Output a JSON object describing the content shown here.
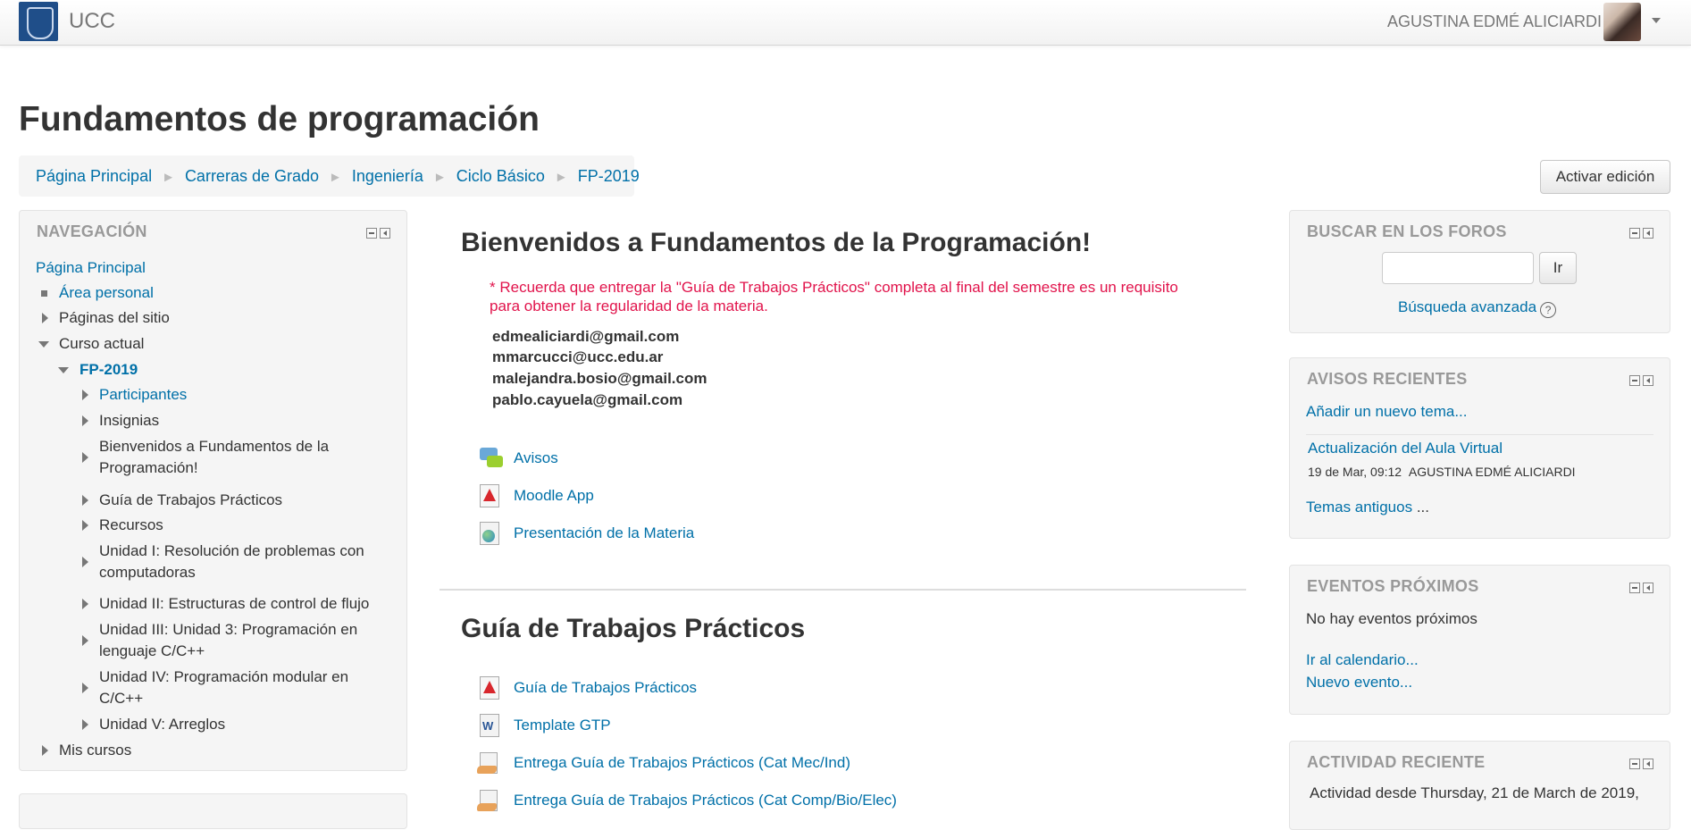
{
  "header": {
    "brand": "UCC",
    "user_name": "AGUSTINA EDMÉ ALICIARDI"
  },
  "page": {
    "title": "Fundamentos de programación",
    "edit_button": "Activar edición"
  },
  "breadcrumb": [
    "Página Principal",
    "Carreras de Grado",
    "Ingeniería",
    "Ciclo Básico",
    "FP-2019"
  ],
  "breadcrumb_separator": "►",
  "navigation": {
    "title": "NAVEGACIÓN",
    "home": "Página Principal",
    "personal": "Área personal",
    "site_pages": "Páginas del sitio",
    "current_course": "Curso actual",
    "course": "FP-2019",
    "sections": [
      "Participantes",
      "Insignias",
      "Bienvenidos a Fundamentos de la",
      "Programación!",
      "Guía de Trabajos Prácticos",
      "Recursos",
      "Unidad I: Resolución de problemas con",
      "computadoras",
      "Unidad II: Estructuras de control de flujo",
      "Unidad III: Unidad 3: Programación en",
      "lenguaje C/C++",
      "Unidad IV: Programación modular en",
      "C/C++",
      "Unidad V: Arreglos"
    ],
    "my_courses": "Mis cursos"
  },
  "main": {
    "welcome_title": "Bienvenidos a Fundamentos de la Programación!",
    "notice_line1": "* Recuerda que entregar la \"Guía de Trabajos Prácticos\" completa al final del semestre es un requisito",
    "notice_line2": "para obtener la regularidad de la materia.",
    "emails": [
      "edmealiciardi@gmail.com",
      "mmarcucci@ucc.edu.ar",
      "malejandra.bosio@gmail.com",
      "pablo.cayuela@gmail.com"
    ],
    "activities": [
      {
        "label": "Avisos",
        "icon": "forum-icon"
      },
      {
        "label": "Moodle App",
        "icon": "pdf-icon"
      },
      {
        "label": "Presentación de la Materia",
        "icon": "url-icon"
      }
    ],
    "section2_title": "Guía de Trabajos Prácticos",
    "section2_activities": [
      {
        "label": "Guía de Trabajos Prácticos",
        "icon": "pdf-icon"
      },
      {
        "label": "Template GTP",
        "icon": "word-icon"
      },
      {
        "label": "Entrega Guía de Trabajos Prácticos (Cat Mec/Ind)",
        "icon": "assignment-icon"
      },
      {
        "label": "Entrega Guía de Trabajos Prácticos (Cat Comp/Bio/Elec)",
        "icon": "assignment-icon"
      }
    ]
  },
  "forum_search": {
    "title": "BUSCAR EN LOS FOROS",
    "button": "Ir",
    "advanced": "Búsqueda avanzada",
    "help": "?"
  },
  "news": {
    "title": "AVISOS RECIENTES",
    "add_topic": "Añadir un nuevo tema...",
    "post_title": "Actualización del Aula Virtual",
    "post_date": "19 de Mar, 09:12",
    "post_author": "AGUSTINA EDMÉ ALICIARDI",
    "older_topics": "Temas antiguos",
    "older_suffix": "..."
  },
  "events": {
    "title": "EVENTOS PRÓXIMOS",
    "none": "No hay eventos próximos",
    "calendar": "Ir al calendario...",
    "new_event": "Nuevo evento..."
  },
  "activity": {
    "title": "ACTIVIDAD RECIENTE",
    "since": "Actividad desde Thursday, 21 de March de 2019,"
  }
}
